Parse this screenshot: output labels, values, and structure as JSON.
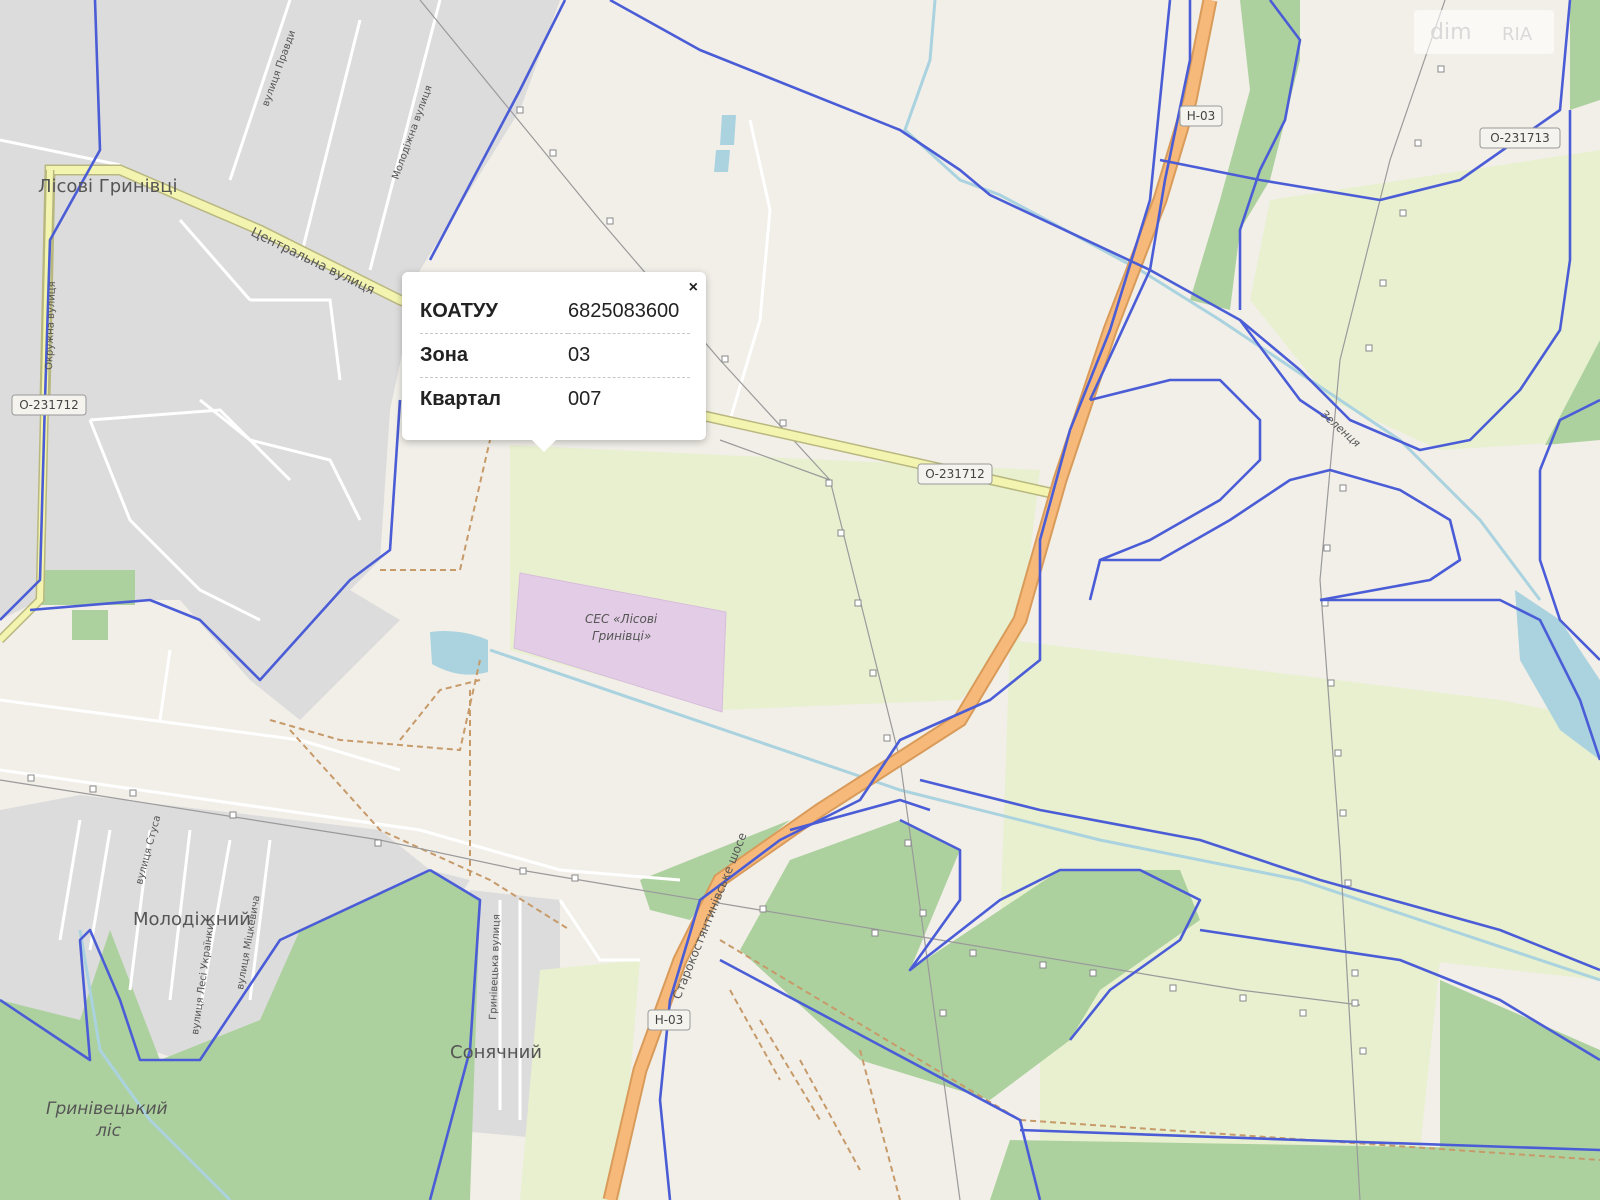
{
  "map": {
    "places": {
      "lisovi_hrynivtsi": "Лісові Гринівці",
      "molodizhnyi": "Молодіжний",
      "soniachnyi": "Сонячний",
      "forest": [
        "Гринівецький",
        "ліс"
      ],
      "ses": [
        "СЕС «Лісові",
        "Гринівці»"
      ]
    },
    "streets": {
      "tsentralna": "Центральна вулиця",
      "molodizhna": "Молодіжна вулиця",
      "pravdy": "вулиця Правди",
      "okruzhna": "Окружна вулиця",
      "stusa": "вулиця Стуса",
      "lesi": "вулиця Лесі Українки",
      "miskevycha": "вулиця Міцкевича",
      "hrynivetska": "Гринівецька вулиця",
      "starokost": "Старокостянтинівське шосе",
      "river": "Зеленця"
    },
    "shields": {
      "h03": "Н-03",
      "o231713": "О-231713",
      "o231712": "О-231712"
    },
    "colors": {
      "background": "#f2efe9",
      "residential": "#dcdcdc",
      "forest": "#add19e",
      "meadow": "#e8f0d0",
      "industrial": "#e3cde6",
      "water": "#aad3df",
      "boundary": "#4b5dd6",
      "primary_road": "#f7b97a",
      "secondary_road": "#f3f4b0",
      "footpath": "#c79a6a"
    }
  },
  "popup": {
    "rows": [
      {
        "key": "КОАТУУ",
        "value": "6825083600"
      },
      {
        "key": "Зона",
        "value": "03"
      },
      {
        "key": "Квартал",
        "value": "007"
      }
    ],
    "close_label": "×"
  },
  "watermark": {
    "left": "dim",
    "right": "RIA"
  }
}
